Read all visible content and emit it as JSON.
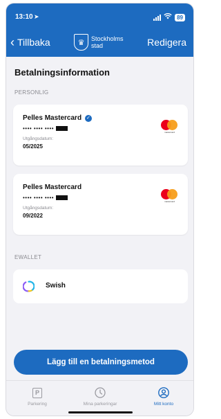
{
  "status_bar": {
    "time": "13:10",
    "location_arrow": "➤",
    "battery": "89"
  },
  "nav": {
    "back_label": "Tillbaka",
    "logo_line1": "Stockholms",
    "logo_line2": "stad",
    "edit_label": "Redigera"
  },
  "page_title": "Betalningsinformation",
  "sections": {
    "personal": "PERSONLIG",
    "ewallet": "EWALLET"
  },
  "cards": [
    {
      "name": "Pelles Mastercard",
      "masked_number": "•••• •••• ••••",
      "expiry_label": "Utgångsdatum:",
      "expiry": "05/2025",
      "verified": true,
      "brand_text": "mastercard"
    },
    {
      "name": "Pelles Mastercard",
      "masked_number": "•••• •••• ••••",
      "expiry_label": "Utgångsdatum:",
      "expiry": "09/2022",
      "verified": false,
      "brand_text": "mastercard"
    }
  ],
  "ewallet": {
    "label": "Swish"
  },
  "cta_label": "Lägg till en betalningsmetod",
  "tabs": [
    {
      "label": "Parkering",
      "icon": "P"
    },
    {
      "label": "Mina parkeringar"
    },
    {
      "label": "Mitt konto"
    }
  ],
  "colors": {
    "brand_blue": "#1d6bc0",
    "background": "#f2f2f6",
    "mc_red": "#eb001b",
    "mc_yellow": "#f79e1b"
  }
}
